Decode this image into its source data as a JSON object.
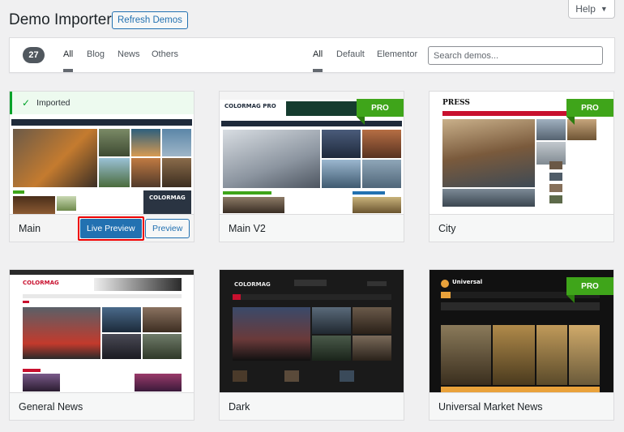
{
  "header": {
    "title": "Demo Importer",
    "refresh_label": "Refresh Demos",
    "help_label": "Help"
  },
  "filters": {
    "count": "27",
    "categories": [
      "All",
      "Blog",
      "News",
      "Others"
    ],
    "builders": [
      "All",
      "Default",
      "Elementor"
    ],
    "active_category": "All",
    "active_builder": "All",
    "search_placeholder": "Search demos..."
  },
  "demos": [
    {
      "name": "Main",
      "imported_label": "Imported",
      "live_preview_label": "Live Preview",
      "preview_label": "Preview",
      "pro": false,
      "thumb_logo": "COLORMAG"
    },
    {
      "name": "Main V2",
      "pro": true,
      "pro_label": "PRO",
      "thumb_logo": "COLORMAG PRO"
    },
    {
      "name": "City",
      "pro": true,
      "pro_label": "PRO",
      "thumb_logo": "PRESS"
    },
    {
      "name": "General News",
      "pro": false,
      "thumb_logo": "COLORMAG"
    },
    {
      "name": "Dark",
      "pro": false,
      "thumb_logo": "COLORMAG"
    },
    {
      "name": "Universal Market News",
      "pro": true,
      "pro_label": "PRO",
      "thumb_logo": "Universal"
    }
  ],
  "colors": {
    "wp_blue": "#2271b1",
    "pro_green": "#3fa51a",
    "highlight_red": "#e00000",
    "imported_green": "#00a32a"
  }
}
